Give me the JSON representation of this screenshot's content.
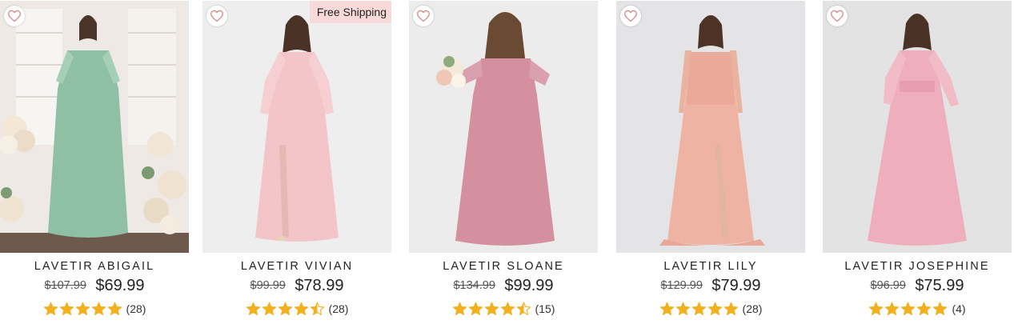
{
  "colors": {
    "star": "#f2b01e",
    "star_empty": "#e7e7e7",
    "badge_bg": "#f9dada",
    "heart": "#d58a8a"
  },
  "products": [
    {
      "name": "LAVETIR ABIGAIL",
      "original_price": "$107.99",
      "sale_price": "$69.99",
      "rating": 5,
      "review_count": "(28)",
      "badge": "",
      "image": "model-in-sage-green-chiffon-dress",
      "dress_color": "#8fbfa4",
      "bg_color": "#eee9e4"
    },
    {
      "name": "LAVETIR VIVIAN",
      "original_price": "$99.99",
      "sale_price": "$78.99",
      "rating": 4.5,
      "review_count": "(28)",
      "badge": "Free Shipping",
      "image": "model-in-blush-pink-long-sleeve-dress",
      "dress_color": "#f3c4c8",
      "bg_color": "#eeeeee"
    },
    {
      "name": "LAVETIR SLOANE",
      "original_price": "$134.99",
      "sale_price": "$99.99",
      "rating": 4.5,
      "review_count": "(15)",
      "badge": "",
      "image": "model-in-dusty-rose-dress-with-bouquet",
      "dress_color": "#d5909f",
      "bg_color": "#ececec"
    },
    {
      "name": "LAVETIR LILY",
      "original_price": "$129.99",
      "sale_price": "$79.99",
      "rating": 5,
      "review_count": "(28)",
      "badge": "",
      "image": "model-in-peach-lace-off-shoulder-dress",
      "dress_color": "#efb3a4",
      "bg_color": "#e4e4e6"
    },
    {
      "name": "LAVETIR JOSEPHINE",
      "original_price": "$96.99",
      "sale_price": "$75.99",
      "rating": 5,
      "review_count": "(4)",
      "badge": "",
      "image": "model-in-pink-long-sleeve-chiffon-dress",
      "dress_color": "#eeaebd",
      "bg_color": "#e3e3e3"
    }
  ]
}
